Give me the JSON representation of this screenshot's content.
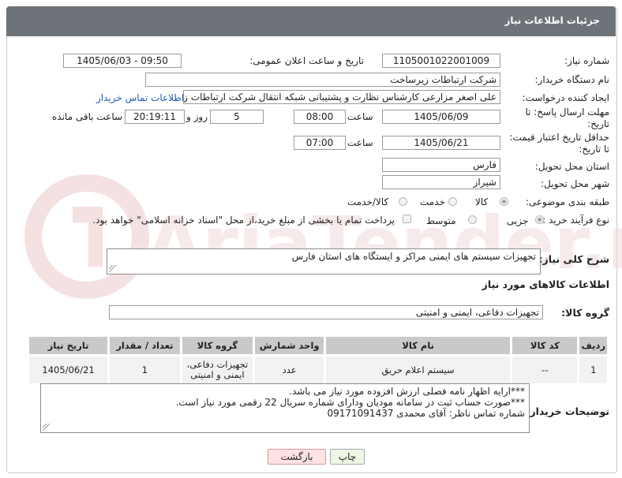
{
  "panel": {
    "title": "جزئیات اطلاعات نیاز"
  },
  "watermark": {
    "text": "AriaTender.net"
  },
  "fields": {
    "need_number": {
      "label": "شماره نیاز:",
      "value": "1105001022001009"
    },
    "announce": {
      "label": "تاریخ و ساعت اعلان عمومی:",
      "value": "1405/06/03 - 09:50"
    },
    "buyer_org": {
      "label": "نام دستگاه خریدار:",
      "value": "شرکت ارتباطات زیرساخت"
    },
    "requester": {
      "label": "ایجاد کننده درخواست:",
      "value": "علی اصغر مزارعی کارشناس نظارت و پشتیبانی شبکه انتقال شرکت ارتباطات زی",
      "link": "اطلاعات تماس خریدار"
    },
    "response_deadline": {
      "label_line1": "مهلت ارسال پاسخ: تا",
      "label_line2": "تاریخ:",
      "date": "1405/06/09",
      "time_label": "ساعت",
      "time": "08:00",
      "days": "5",
      "days_label": "روز و",
      "remaining": "20:19:11",
      "remaining_label": "ساعت باقی مانده"
    },
    "price_validity": {
      "label_line1": "حداقل تاریخ اعتبار قیمت:",
      "label_line2": "تا تاریخ:",
      "date": "1405/06/21",
      "time_label": "ساعت",
      "time": "07:00"
    },
    "delivery_province": {
      "label": "استان محل تحویل:",
      "value": "فارس"
    },
    "delivery_city": {
      "label": "شهر محل تحویل:",
      "value": "شیراز"
    },
    "category": {
      "label": "طبقه بندی موضوعی:",
      "options": [
        "کالا",
        "خدمت",
        "کالا/خدمت"
      ],
      "selected": 0
    },
    "purchase_process": {
      "label": "نوع فرآیند خرید :",
      "options": [
        "جزیی",
        "متوسط"
      ],
      "selected": 0,
      "payment_note": "پرداخت تمام یا بخشی از مبلغ خرید،از محل \"اسناد خزانه اسلامی\" خواهد بود."
    }
  },
  "description": {
    "label": "شرح کلی نیاز:",
    "value": "تجهیزات سیستم های ایمنی مراکز و ایستگاه های استان فارس"
  },
  "goods_section": {
    "title": "اطلاعات کالاهای مورد نیاز",
    "group_label": "گروه کالا:",
    "group_value": "تجهیزات دفاعی، ایمنی و امنیتی"
  },
  "table": {
    "headers": [
      "ردیف",
      "کد کالا",
      "نام کالا",
      "واحد شمارش",
      "گروه کالا",
      "تعداد / مقدار",
      "تاریخ نیاز"
    ],
    "rows": [
      [
        "1",
        "--",
        "سیستم اعلام حریق",
        "عدد",
        "تجهیزات دفاعی، ایمنی و امنیتی",
        "1",
        "1405/06/21"
      ]
    ]
  },
  "buyer_notes": {
    "label": "توضیحات خریدار:",
    "lines": [
      "***ارایه اظهار نامه فصلی ارزش افزوده مورد نیاز می باشد.",
      "***صورت حساب ثبت در سامانه مودیان ودارای شماره سریال 22 رقمی مورد نیاز است.",
      "شماره تماس ناظر: آقای محمدی 09171091437"
    ]
  },
  "buttons": {
    "print": "چاپ",
    "back": "بازگشت"
  },
  "colors": {
    "header_bg": "#6e7379",
    "table_header_bg": "#c9c9c9",
    "table_row_bg": "#f2f2f2",
    "link": "#1f5bb3",
    "print_btn_bg": "#eef7e6",
    "back_btn_bg": "#fde3e3",
    "watermark": "#f0dcdc"
  }
}
